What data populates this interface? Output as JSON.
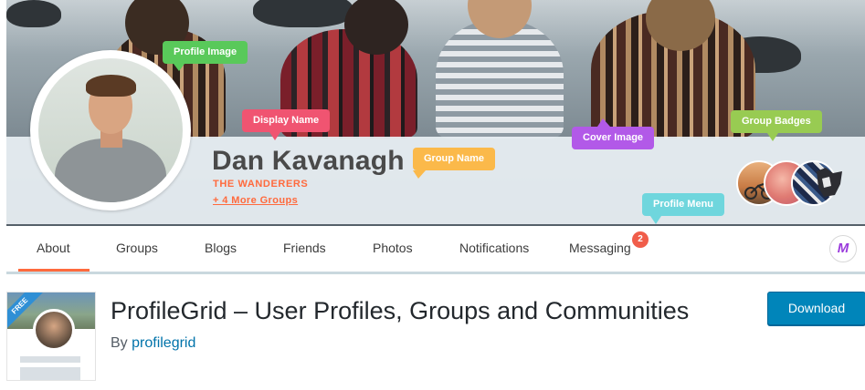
{
  "banner": {
    "display_name": "Dan Kavanagh",
    "group_name": "THE WANDERERS",
    "more_groups": "+ 4 More Groups"
  },
  "callouts": {
    "profile_image": "Profile Image",
    "display_name": "Display Name",
    "group_name": "Group Name",
    "cover_image": "Cover Image",
    "group_badges": "Group Badges",
    "profile_menu": "Profile Menu"
  },
  "tabs": [
    {
      "label": "About",
      "active": true
    },
    {
      "label": "Groups"
    },
    {
      "label": "Blogs"
    },
    {
      "label": "Friends"
    },
    {
      "label": "Photos"
    },
    {
      "label": "Notifications"
    },
    {
      "label": "Messaging"
    }
  ],
  "messaging_count": "2",
  "logo_letter": "M",
  "plugin": {
    "ribbon": "FREE",
    "title": "ProfileGrid – User Profiles, Groups and Communities",
    "by_prefix": "By",
    "author": "profilegrid",
    "download_label": "Download"
  },
  "colors": {
    "accent": "#ff6a3d",
    "download_bg": "#0085ba",
    "link": "#0073aa"
  }
}
